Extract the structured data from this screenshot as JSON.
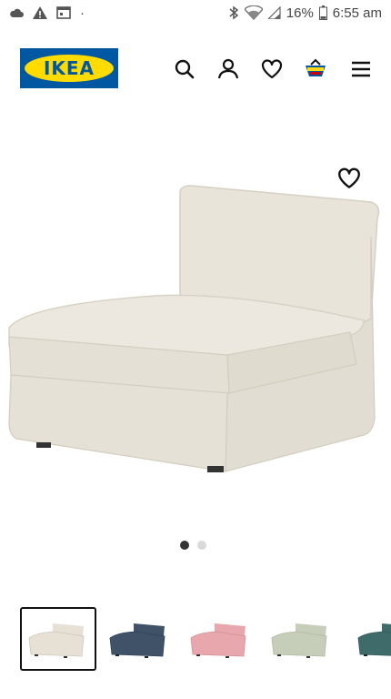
{
  "status_bar": {
    "battery": "16%",
    "time": "6:55 am",
    "dot": "·"
  },
  "header": {
    "logo_text": "IKEA",
    "icons": [
      "search-icon",
      "account-icon",
      "heart-icon",
      "cart-icon",
      "menu-icon"
    ]
  },
  "product": {
    "favourite_icon": "heart-outline-icon",
    "main_color": "#e8e3d9"
  },
  "carousel": {
    "count": 2,
    "active_index": 0
  },
  "thumbnails": [
    {
      "color": "#e6e0d5",
      "selected": true
    },
    {
      "color": "#3f5268",
      "selected": false
    },
    {
      "color": "#e7a7ad",
      "selected": false
    },
    {
      "color": "#c6ceb9",
      "selected": false
    },
    {
      "color": "#3f6b6a",
      "selected": false
    }
  ],
  "colors": {
    "logo_blue": "#0058a3",
    "logo_yellow": "#ffdb00",
    "cart_accent": "#fbd914",
    "cart_red": "#cc0008",
    "cart_blue": "#0058a3"
  }
}
